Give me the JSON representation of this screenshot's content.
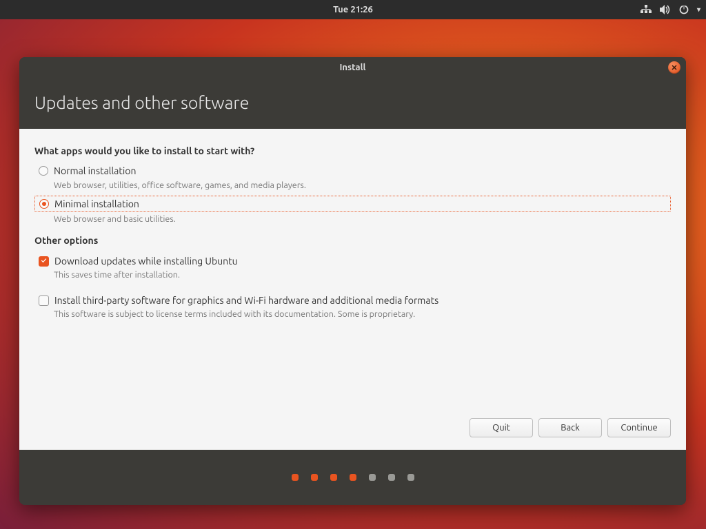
{
  "topbar": {
    "datetime": "Tue 21:26"
  },
  "window": {
    "title": "Install",
    "close_glyph": "✕",
    "heading": "Updates and other software"
  },
  "content": {
    "question": "What apps would you like to install to start with?",
    "option_normal": {
      "label": "Normal installation",
      "desc": "Web browser, utilities, office software, games, and media players.",
      "selected": false
    },
    "option_minimal": {
      "label": "Minimal installation",
      "desc": "Web browser and basic utilities.",
      "selected": true
    },
    "other_heading": "Other options",
    "opt_updates": {
      "label": "Download updates while installing Ubuntu",
      "desc": "This saves time after installation.",
      "checked": true
    },
    "opt_thirdparty": {
      "label": "Install third-party software for graphics and Wi-Fi hardware and additional media formats",
      "desc": "This software is subject to license terms included with its documentation. Some is proprietary.",
      "checked": false
    }
  },
  "buttons": {
    "quit": "Quit",
    "back": "Back",
    "continue": "Continue"
  },
  "progress": {
    "total": 7,
    "completed": 4
  }
}
